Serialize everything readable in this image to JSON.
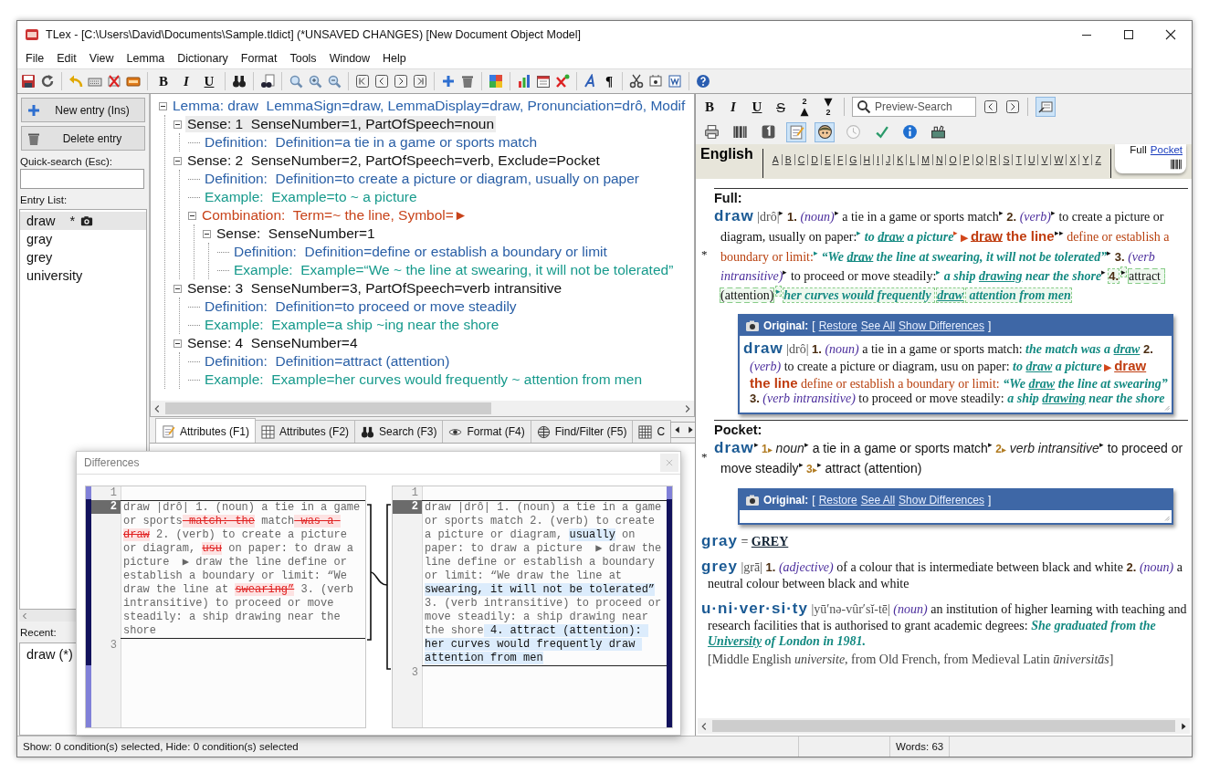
{
  "window": {
    "title": "TLex - [C:\\Users\\David\\Documents\\Sample.tldict] (*UNSAVED CHANGES) [New Document Object Model]"
  },
  "menu": [
    "File",
    "Edit",
    "View",
    "Lemma",
    "Dictionary",
    "Format",
    "Tools",
    "Window",
    "Help"
  ],
  "toolbar": {
    "format_buttons": [
      {
        "kind": "bold",
        "label": "B"
      },
      {
        "kind": "italic",
        "label": "I"
      },
      {
        "kind": "underline",
        "label": "U"
      }
    ],
    "paragraph_mark": "¶"
  },
  "left_panel": {
    "buttons": [
      {
        "kind": "new",
        "label": "New entry (Ins)"
      },
      {
        "kind": "delete",
        "label": "Delete entry"
      }
    ],
    "search_label": "Quick-search (Esc):",
    "list_label": "Entry List:",
    "entries": [
      {
        "label": "draw",
        "flag": "*",
        "snapshot": true,
        "selected": true
      },
      {
        "label": "gray",
        "snapshot": false,
        "selected": false
      },
      {
        "label": "grey",
        "snapshot": false,
        "selected": false
      },
      {
        "label": "university",
        "snapshot": false,
        "selected": false
      }
    ],
    "recent_label": "Recent:",
    "recent": [
      "draw (*)"
    ]
  },
  "tree": [
    {
      "kind": "lemma",
      "text": "Lemma: draw  LemmaSign=draw, LemmaDisplay=draw, Pronunciation=drô, Modif",
      "expanded": true,
      "selected": false,
      "children": [
        {
          "kind": "sense",
          "text": "Sense: 1  SenseNumber=1, PartOfSpeech=noun",
          "expanded": true,
          "selected": true,
          "children": [
            {
              "kind": "definition",
              "text": "Definition:  Definition=a tie in a game or sports match",
              "selected": false
            }
          ]
        },
        {
          "kind": "sense",
          "text": "Sense: 2  SenseNumber=2, PartOfSpeech=verb, Exclude=Pocket",
          "expanded": true,
          "selected": false,
          "children": [
            {
              "kind": "definition",
              "text": "Definition:  Definition=to create a picture or diagram, usually on paper",
              "selected": false
            },
            {
              "kind": "example",
              "text": "Example:  Example=to ~ a picture",
              "selected": false
            },
            {
              "kind": "combination",
              "text": "Combination:  Term=~ the line, Symbol=►",
              "expanded": true,
              "selected": false,
              "children": [
                {
                  "kind": "sense",
                  "text": "Sense:  SenseNumber=1",
                  "expanded": true,
                  "selected": false,
                  "children": [
                    {
                      "kind": "definition",
                      "text": "Definition:  Definition=define or establish a boundary or limit",
                      "selected": false
                    },
                    {
                      "kind": "example",
                      "text": "Example:  Example=“We ~ the line at swearing, it will not be tolerated”",
                      "selected": false
                    }
                  ]
                }
              ]
            }
          ]
        },
        {
          "kind": "sense",
          "text": "Sense: 3  SenseNumber=3, PartOfSpeech=verb intransitive",
          "expanded": true,
          "selected": false,
          "children": [
            {
              "kind": "definition",
              "text": "Definition:  Definition=to proceed or move steadily",
              "selected": false
            },
            {
              "kind": "example",
              "text": "Example:  Example=a ship ~ing near the shore",
              "selected": false
            }
          ]
        },
        {
          "kind": "sense",
          "text": "Sense: 4  SenseNumber=4",
          "expanded": true,
          "selected": false,
          "children": [
            {
              "kind": "definition",
              "text": "Definition:  Definition=attract (attention)",
              "selected": false
            },
            {
              "kind": "example",
              "text": "Example:  Example=her curves would frequently ~ attention from men",
              "selected": false
            }
          ]
        }
      ]
    }
  ],
  "tabs": [
    {
      "label": "Attributes (F1)",
      "selected": true
    },
    {
      "label": "Attributes (F2)",
      "selected": false
    },
    {
      "label": "Search (F3)",
      "selected": false
    },
    {
      "label": "Format (F4)",
      "selected": false
    },
    {
      "label": "Find/Filter (F5)",
      "selected": false
    },
    {
      "label": "C",
      "selected": false
    }
  ],
  "differences": {
    "title": "Differences",
    "left": [
      {
        "number": "1",
        "current": false
      },
      {
        "number": "2",
        "current": true,
        "segments": [
          {
            "kind": "same",
            "t": "draw |drô| 1. (noun) a tie in a game or sports"
          },
          {
            "kind": "deleted",
            "t": " match: the"
          },
          {
            "kind": "same",
            "t": " match"
          },
          {
            "kind": "deleted",
            "t": " was a draw"
          },
          {
            "kind": "same",
            "t": " 2. (verb) to create a picture or diagram, "
          },
          {
            "kind": "deleted",
            "t": "usu"
          },
          {
            "kind": "same",
            "t": " on paper: to draw a picture  ▶ draw the line define or establish a boundary or limit: “We draw the line at "
          },
          {
            "kind": "deleted",
            "t": "swearing”"
          },
          {
            "kind": "same",
            "t": " 3. (verb intransitive) to proceed or move steadily: a ship drawing near the shore"
          }
        ]
      },
      {
        "number": "3",
        "current": false
      }
    ],
    "right": [
      {
        "number": "1",
        "current": false
      },
      {
        "number": "2",
        "current": true,
        "segments": [
          {
            "kind": "same",
            "t": "draw |drô| 1. (noun) a tie in a game or sports match 2. (verb) to create a picture or diagram, "
          },
          {
            "kind": "inserted",
            "t": "usually"
          },
          {
            "kind": "same",
            "t": " on paper: to draw a picture  ▶ draw the line define or establish a boundary or limit: “We draw the line at "
          },
          {
            "kind": "inserted",
            "t": "swearing, it will not be tolerated”"
          },
          {
            "kind": "same",
            "t": " 3. (verb intransitive) to proceed or move steadily: a ship drawing near the shore"
          },
          {
            "kind": "inserted",
            "t": " 4. attract (attention): her curves would frequently draw attention from men"
          }
        ]
      },
      {
        "number": "3",
        "current": false
      }
    ]
  },
  "preview": {
    "format_buttons": [
      {
        "kind": "bold",
        "label": "B"
      },
      {
        "kind": "italic",
        "label": "I"
      },
      {
        "kind": "underline",
        "label": "U"
      },
      {
        "kind": "strike",
        "label": "S"
      },
      {
        "kind": "superscript",
        "label": "2"
      },
      {
        "kind": "subscript",
        "label": "2"
      }
    ],
    "search": {
      "placeholder": "Preview-Search"
    },
    "layout_toggle": {
      "pressed": true
    },
    "view_buttons": [
      {
        "pressed": false
      },
      {
        "pressed": false
      },
      {
        "pressed": false
      },
      {
        "pressed": true
      },
      {
        "pressed": true
      },
      {
        "pressed": false
      },
      {
        "pressed": false
      },
      {
        "pressed": false
      },
      {
        "pressed": false
      }
    ],
    "language": "English",
    "letters": [
      "A",
      "B",
      "C",
      "D",
      "E",
      "F",
      "G",
      "H",
      "I",
      "J",
      "K",
      "L",
      "M",
      "N",
      "O",
      "P",
      "Q",
      "R",
      "S",
      "T",
      "U",
      "V",
      "W",
      "X",
      "Y",
      "Z"
    ],
    "modes": [
      {
        "label": "Full",
        "selected": true
      },
      {
        "label": "Pocket",
        "selected": false
      }
    ],
    "sections": [
      {
        "kind": "full",
        "heading": "Full:",
        "marker": "*",
        "entry": [
          {
            "kind": "hw",
            "t": "draw"
          },
          {
            "kind": "pron",
            "t": " |drô|"
          },
          {
            "kind": "mk",
            "t": "▸"
          },
          {
            "kind": "num",
            "t": " 1."
          },
          {
            "kind": "pos",
            "t": " (noun)"
          },
          {
            "kind": "mk",
            "t": "▸"
          },
          {
            "kind": "txt",
            "t": " a tie in a game or sports match"
          },
          {
            "kind": "mk",
            "t": "▸"
          },
          {
            "kind": "num",
            "t": " 2."
          },
          {
            "kind": "pos",
            "t": " (verb)"
          },
          {
            "kind": "mk",
            "t": "▸"
          },
          {
            "kind": "txt",
            "t": " to create a picture or diagram, usually on paper:"
          },
          {
            "kind": "mkt",
            "t": "▸"
          },
          {
            "kind": "ex",
            "t": " to "
          },
          {
            "kind": "exu",
            "t": "draw"
          },
          {
            "kind": "ex",
            "t": " a picture"
          },
          {
            "kind": "mkr",
            "t": "▸"
          },
          {
            "kind": "sym",
            "t": " ▶ "
          },
          {
            "kind": "combou",
            "t": "draw"
          },
          {
            "kind": "combo",
            "t": " the line"
          },
          {
            "kind": "mk",
            "t": "▸▸"
          },
          {
            "kind": "ctext",
            "t": " define or establish a boundary or limit:"
          },
          {
            "kind": "mkt",
            "t": "▸"
          },
          {
            "kind": "ex",
            "t": " “We "
          },
          {
            "kind": "exu",
            "t": "draw"
          },
          {
            "kind": "ex",
            "t": " the line at swearing, it will not be tolerated”"
          },
          {
            "kind": "mk",
            "t": "▸"
          },
          {
            "kind": "num",
            "t": " 3."
          },
          {
            "kind": "pos",
            "t": " (verb intransitive)"
          },
          {
            "kind": "mk",
            "t": "▸"
          },
          {
            "kind": "txt",
            "t": " to proceed or move steadily:"
          },
          {
            "kind": "mkt",
            "t": "▸"
          },
          {
            "kind": "ex",
            "t": " a ship "
          },
          {
            "kind": "exu",
            "t": "drawing"
          },
          {
            "kind": "ex",
            "t": " near the shore"
          },
          {
            "kind": "mk",
            "t": "▸"
          }
        ],
        "added": [
          {
            "kind": "num",
            "t": "4."
          },
          {
            "kind": "mk",
            "t": "▸"
          },
          {
            "kind": "txt",
            "t": "attract (attention)"
          },
          {
            "kind": "mkt",
            "t": "▸"
          },
          {
            "kind": "ex",
            "t": "her curves would frequently "
          },
          {
            "kind": "exu",
            "t": "draw"
          },
          {
            "kind": "ex",
            "t": " attention from men"
          }
        ],
        "original": {
          "label": "Original:",
          "open": "[",
          "links": [
            "Restore",
            "See All",
            "Show Differences"
          ],
          "close": "]",
          "body": [
            {
              "kind": "hw",
              "t": "draw"
            },
            {
              "kind": "pron",
              "t": " |drô|"
            },
            {
              "kind": "num",
              "t": " 1."
            },
            {
              "kind": "pos",
              "t": " (noun)"
            },
            {
              "kind": "txt",
              "t": " a tie in a game or sports match:"
            },
            {
              "kind": "ex",
              "t": " the match was a "
            },
            {
              "kind": "exu",
              "t": "draw"
            },
            {
              "kind": "num",
              "t": " 2."
            },
            {
              "kind": "pos",
              "t": " (verb)"
            },
            {
              "kind": "txt",
              "t": " to create a picture or diagram, usu on paper:"
            },
            {
              "kind": "ex",
              "t": " to "
            },
            {
              "kind": "exu",
              "t": "draw"
            },
            {
              "kind": "ex",
              "t": " a picture"
            },
            {
              "kind": "sym",
              "t": " ▶ "
            },
            {
              "kind": "combou",
              "t": "draw"
            },
            {
              "kind": "combo",
              "t": " the line"
            },
            {
              "kind": "ctext",
              "t": " define or establish a boundary or limit:"
            },
            {
              "kind": "ex",
              "t": " “We "
            },
            {
              "kind": "exu",
              "t": "draw"
            },
            {
              "kind": "ex",
              "t": " the line at swearing”"
            },
            {
              "kind": "num",
              "t": " 3."
            },
            {
              "kind": "pos",
              "t": " (verb intransitive)"
            },
            {
              "kind": "txt",
              "t": " to proceed or move steadily:"
            },
            {
              "kind": "ex",
              "t": " a ship "
            },
            {
              "kind": "exu",
              "t": "drawing"
            },
            {
              "kind": "ex",
              "t": " near the shore"
            }
          ]
        }
      },
      {
        "kind": "pocket",
        "heading": "Pocket:",
        "marker": "*",
        "entry": [
          {
            "kind": "hw",
            "t": "draw"
          },
          {
            "kind": "mk",
            "t": "▸"
          },
          {
            "kind": "pnum",
            "t": " 1"
          },
          {
            "kind": "psym",
            "t": "▸"
          },
          {
            "kind": "pos",
            "t": " noun"
          },
          {
            "kind": "mk",
            "t": "▸"
          },
          {
            "kind": "txt",
            "t": " a tie in a game or sports match"
          },
          {
            "kind": "mk",
            "t": "▸"
          },
          {
            "kind": "pnum",
            "t": " 2"
          },
          {
            "kind": "psym",
            "t": "▸"
          },
          {
            "kind": "pos",
            "t": " verb intransitive"
          },
          {
            "kind": "mk",
            "t": "▸"
          },
          {
            "kind": "txt",
            "t": " to proceed or move steadily"
          },
          {
            "kind": "mk",
            "t": "▸"
          },
          {
            "kind": "pnum",
            "t": " 3"
          },
          {
            "kind": "psym",
            "t": "▸"
          },
          {
            "kind": "mk",
            "t": "▸"
          },
          {
            "kind": "txt",
            "t": " attract (attention)"
          }
        ],
        "original": {
          "label": "Original:",
          "open": "[",
          "links": [
            "Restore",
            "See All",
            "Show Differences"
          ],
          "close": "]"
        }
      }
    ],
    "entries": [
      {
        "segments": [
          {
            "kind": "hw",
            "t": "gray"
          },
          {
            "kind": "txt",
            "t": " = "
          },
          {
            "kind": "xref",
            "t": "GREY"
          }
        ]
      },
      {
        "segments": [
          {
            "kind": "hw",
            "t": "grey"
          },
          {
            "kind": "pron",
            "t": " |grā|"
          },
          {
            "kind": "num",
            "t": " 1."
          },
          {
            "kind": "pos",
            "t": " (adjective)"
          },
          {
            "kind": "txt",
            "t": " of a colour that is intermediate between black and white"
          },
          {
            "kind": "num",
            "t": " 2."
          },
          {
            "kind": "pos",
            "t": " (noun)"
          },
          {
            "kind": "txt",
            "t": " a neutral colour between black and white"
          }
        ]
      },
      {
        "segments": [
          {
            "kind": "hw",
            "t": "u·ni·ver·si·ty"
          },
          {
            "kind": "pron",
            "t": " |yū′nə-vûr′sĭ-tē|"
          },
          {
            "kind": "pos",
            "t": " (noun)"
          },
          {
            "kind": "txt",
            "t": " an institution of higher learning with teaching and research facilities that is authorised to grant academic degrees:"
          },
          {
            "kind": "ex",
            "t": " She graduated from the "
          },
          {
            "kind": "exu",
            "t": "University"
          },
          {
            "kind": "ex",
            "t": " of London in 1981."
          }
        ],
        "etymology": [
          {
            "kind": "ety",
            "t": "[Middle English "
          },
          {
            "kind": "etyi",
            "t": "universite"
          },
          {
            "kind": "ety",
            "t": ", from Old French, from Medieval Latin "
          },
          {
            "kind": "etyi",
            "t": "ūniversitās"
          },
          {
            "kind": "ety",
            "t": "]"
          }
        ]
      }
    ]
  },
  "status_bar": {
    "conditions": "Show: 0 condition(s) selected, Hide: 0 condition(s) selected",
    "words": "Words: 63"
  }
}
